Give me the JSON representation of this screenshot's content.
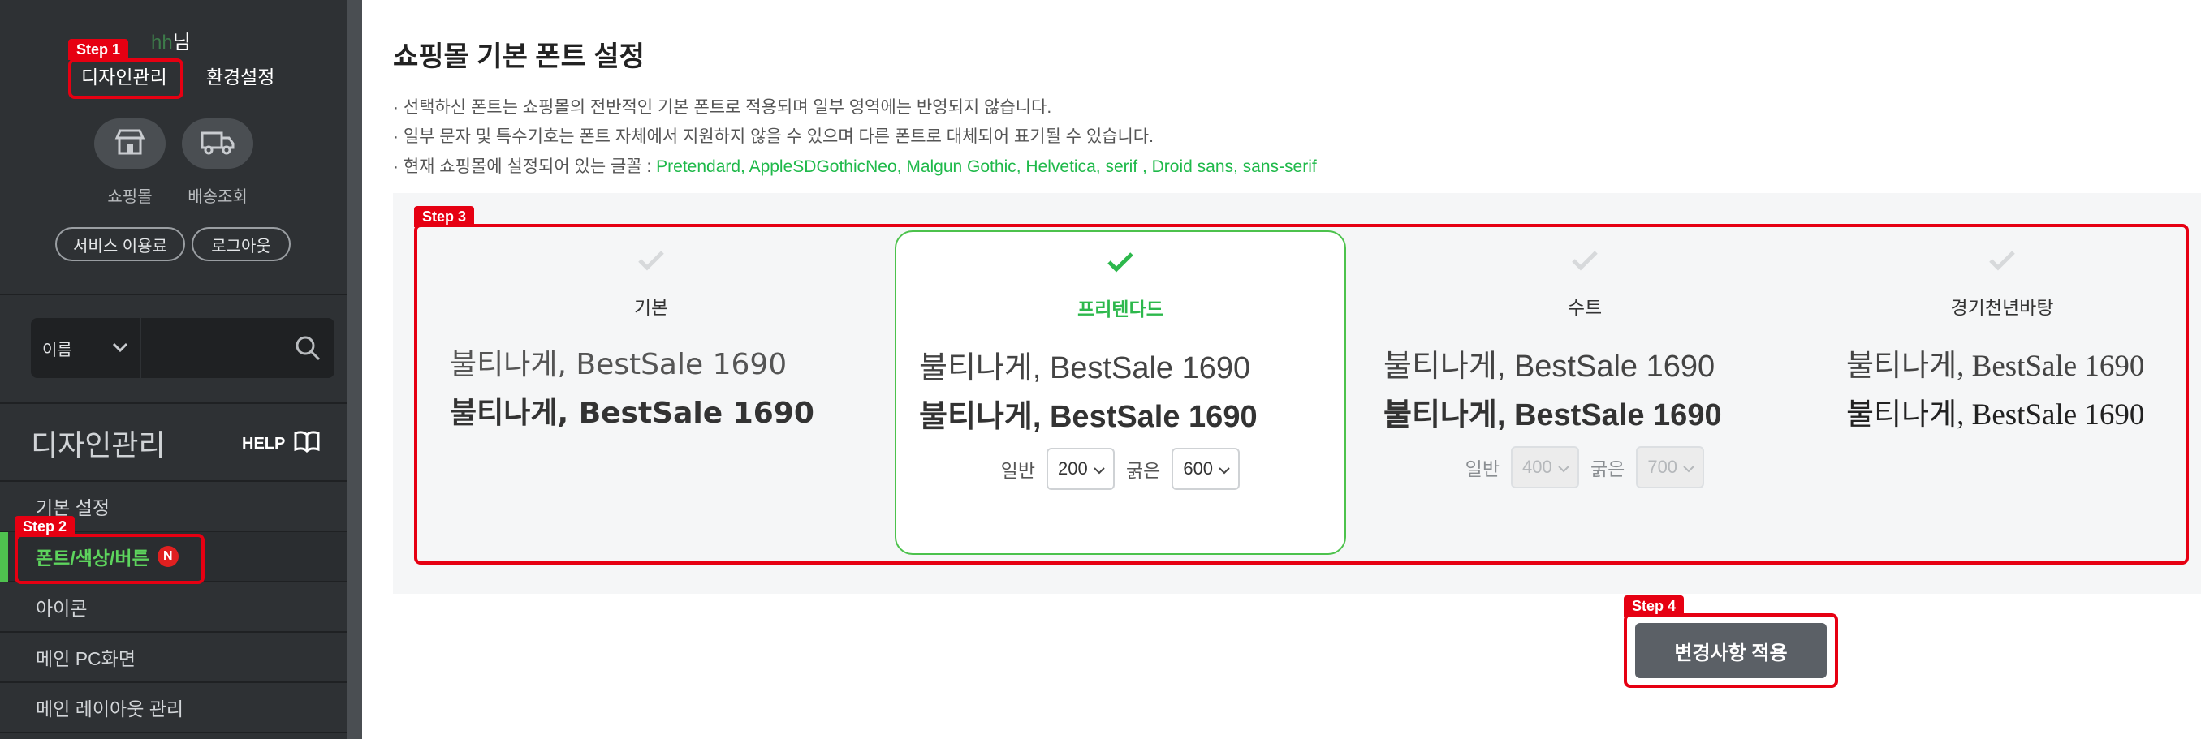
{
  "sidebar": {
    "user": {
      "name": "hh",
      "suffix": "님"
    },
    "tabs": [
      "디자인관리",
      "환경설정"
    ],
    "quick_links": [
      {
        "label": "쇼핑몰",
        "icon": "store-icon"
      },
      {
        "label": "배송조회",
        "icon": "truck-icon"
      }
    ],
    "pills": [
      "서비스 이용료",
      "로그아웃"
    ],
    "search": {
      "select_value": "이름",
      "placeholder": ""
    },
    "section_title": "디자인관리",
    "help_label": "HELP",
    "menu": [
      {
        "label": "기본 설정",
        "active": false
      },
      {
        "label": "폰트/색상/버튼",
        "active": true,
        "badge": "N"
      },
      {
        "label": "아이콘",
        "active": false
      },
      {
        "label": "메인 PC화면",
        "active": false
      },
      {
        "label": "메인 레이아웃 관리",
        "active": false
      }
    ]
  },
  "steps": [
    "Step 1",
    "Step 2",
    "Step 3",
    "Step 4"
  ],
  "main": {
    "title": "쇼핑몰 기본 폰트 설정",
    "notes": [
      "· 선택하신 폰트는 쇼핑몰의 전반적인 기본 폰트로 적용되며 일부 영역에는 반영되지 않습니다.",
      "· 일부 문자 및 특수기호는 폰트 자체에서 지원하지 않을 수 있으며 다른 폰트로 대체되어 표기될 수 있습니다.",
      "· 현재 쇼핑몰에 설정되어 있는 글꼴 : "
    ],
    "current_fonts": "Pretendard, AppleSDGothicNeo, Malgun Gothic, Helvetica, serif , Droid sans, sans-serif",
    "font_cards": [
      {
        "name": "기본",
        "sample_regular": "불티나게, BestSale 1690",
        "sample_bold": "불티나게, BestSale 1690",
        "selected": false
      },
      {
        "name": "프리텐다드",
        "sample_regular": "불티나게, BestSale 1690",
        "sample_bold": "불티나게, BestSale 1690",
        "selected": true,
        "weights": {
          "regular_label": "일반",
          "regular_value": "200",
          "bold_label": "굵은",
          "bold_value": "600"
        }
      },
      {
        "name": "수트",
        "sample_regular": "불티나게, BestSale 1690",
        "sample_bold": "불티나게, BestSale 1690",
        "selected": false,
        "weights": {
          "regular_label": "일반",
          "regular_value": "400",
          "bold_label": "굵은",
          "bold_value": "700"
        }
      },
      {
        "name": "경기천년바탕",
        "sample_regular": "불티나게, BestSale 1690",
        "sample_bold": "불티나게, BestSale 1690",
        "selected": false
      }
    ],
    "apply_button": "변경사항 적용"
  },
  "colors": {
    "accent_green": "#2db84c",
    "step_red": "#e60012",
    "sidebar_bg": "#2e3134"
  }
}
